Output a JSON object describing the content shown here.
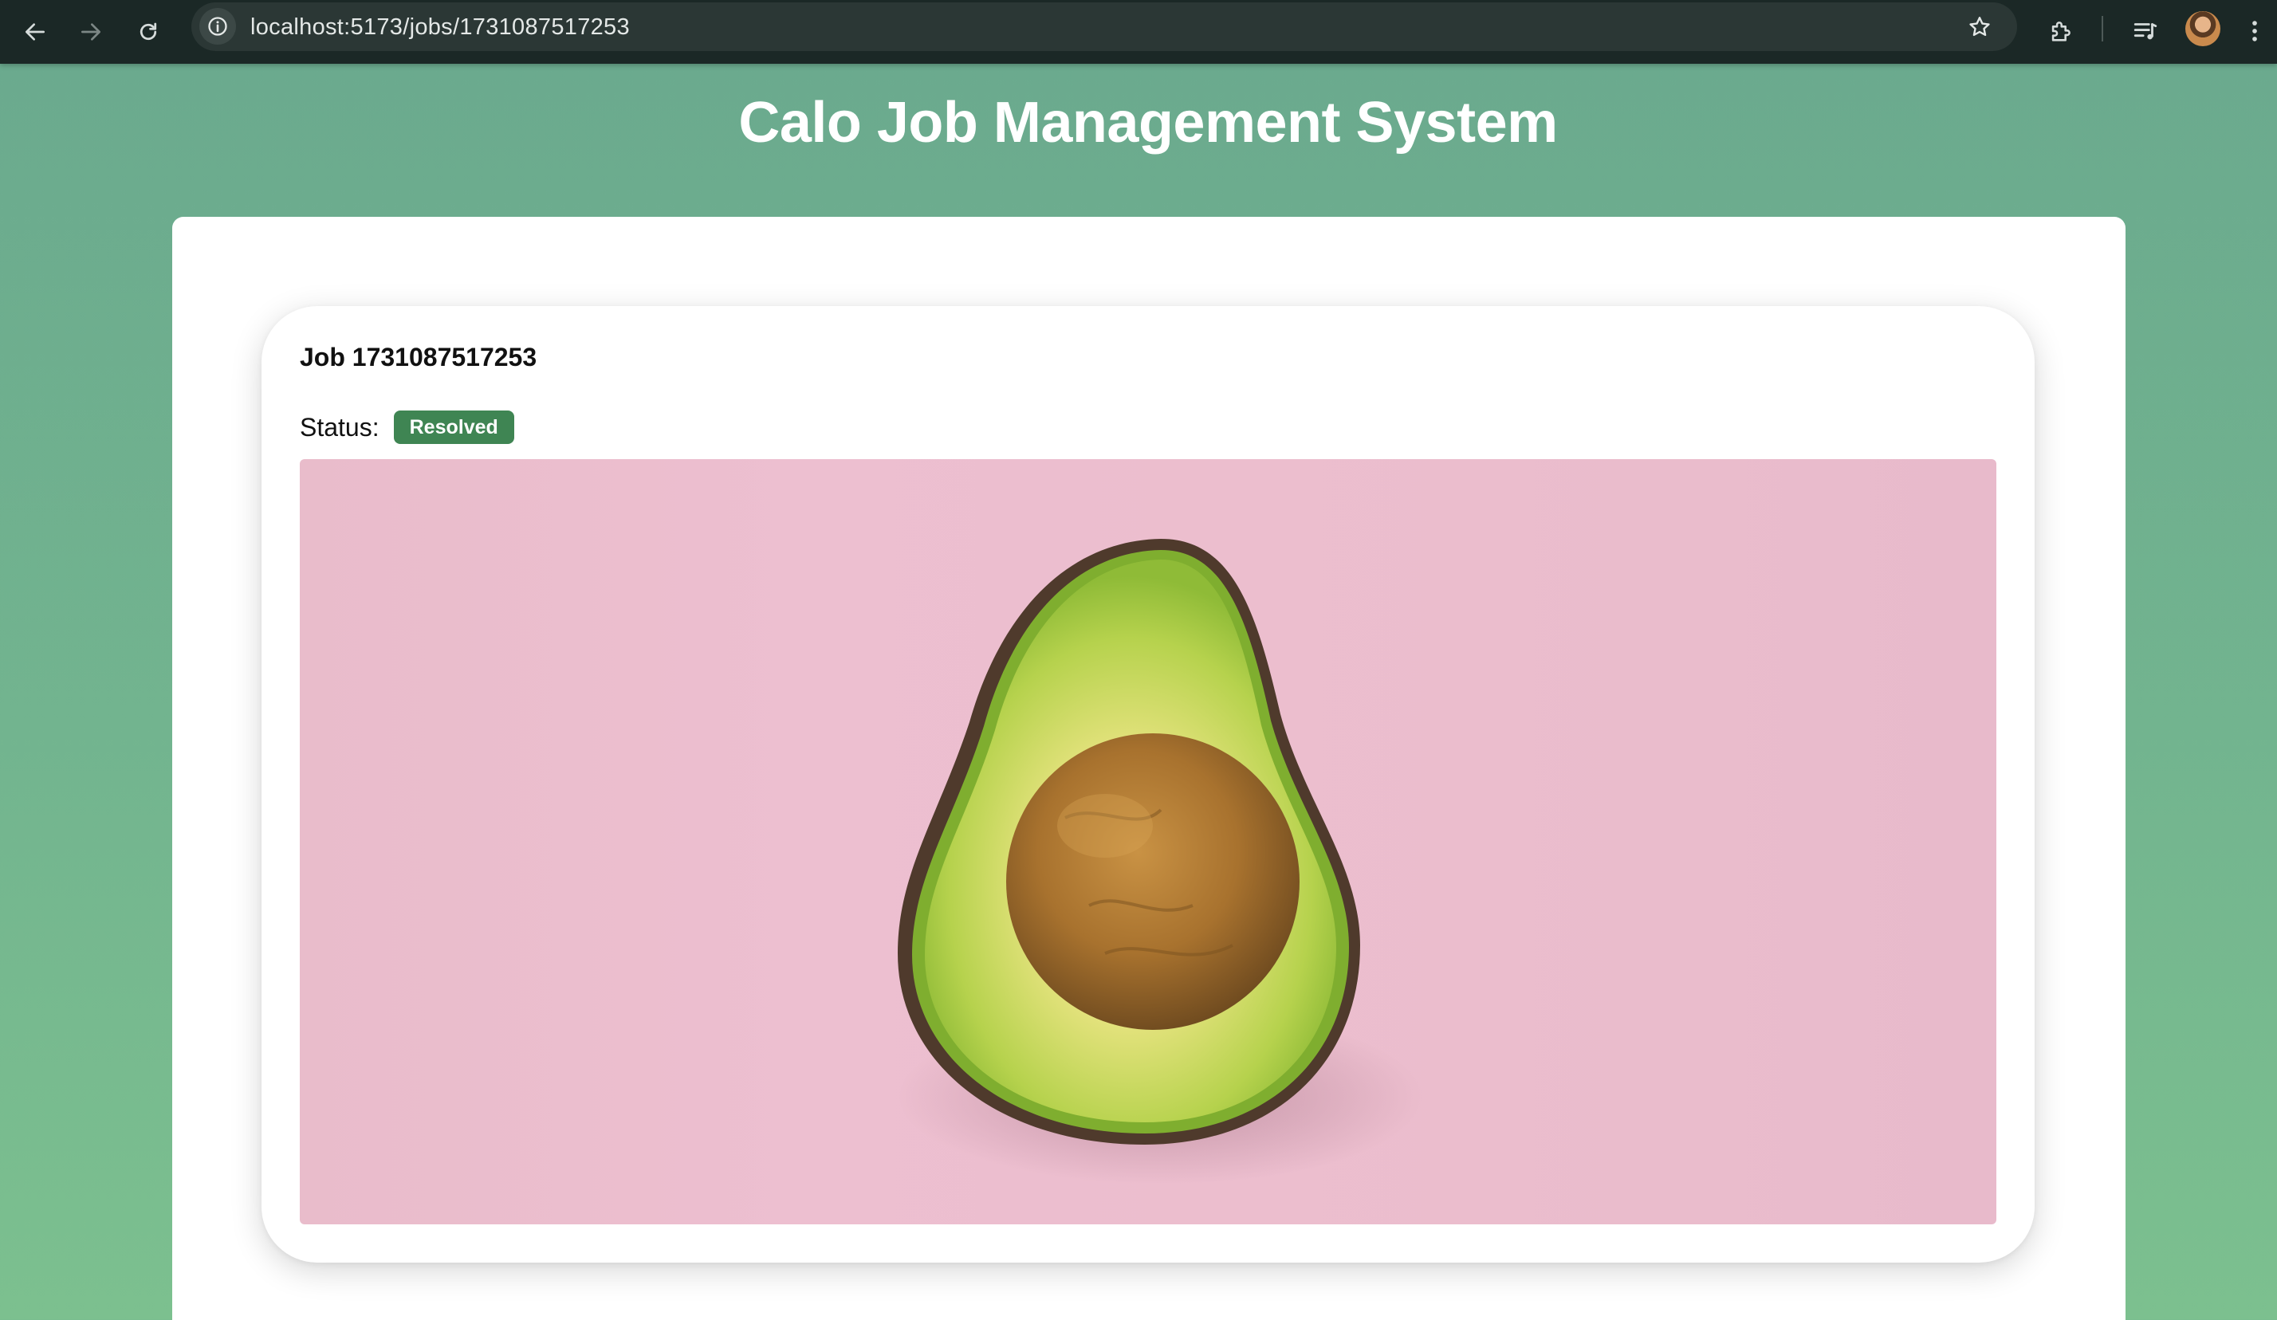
{
  "browser": {
    "url": "localhost:5173/jobs/1731087517253",
    "icons": {
      "back": "arrow-left-icon",
      "forward": "arrow-right-icon",
      "reload": "reload-icon",
      "site_info": "info-icon",
      "bookmark": "star-icon",
      "extensions": "puzzle-icon",
      "media": "media-queue-icon",
      "profile": "avatar",
      "menu": "kebab-menu-icon"
    }
  },
  "page": {
    "title": "Calo Job Management System"
  },
  "job": {
    "title": "Job 1731087517253",
    "status_label": "Status:",
    "status": "Resolved",
    "status_color": "#3f8553",
    "image_subject": "halved-avatar-on-pink-background"
  },
  "colors": {
    "background_green": "#6fae8f",
    "badge_green": "#3f8553",
    "image_pink": "#ebbdcd"
  }
}
